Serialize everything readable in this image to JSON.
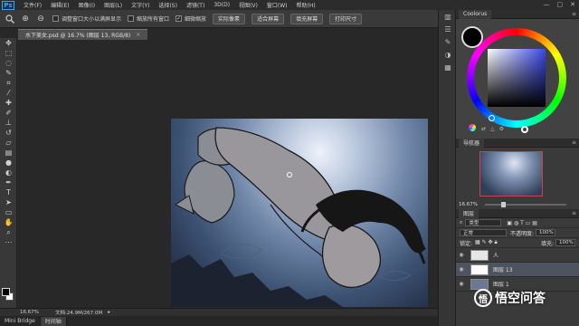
{
  "app": {
    "logo": "Ps"
  },
  "menubar": {
    "items": [
      "文件(F)",
      "编辑(E)",
      "图像(I)",
      "图层(L)",
      "文字(Y)",
      "选择(S)",
      "滤镜(T)",
      "3D(D)",
      "视图(V)",
      "窗口(W)",
      "帮助(H)"
    ]
  },
  "window_controls": {
    "minimize": "—",
    "maximize": "▢",
    "close": "✕"
  },
  "options": {
    "tool_icon": "zoom-tool-icon",
    "zoom_in": "⊕",
    "zoom_out": "⊖",
    "checkboxes": [
      {
        "label": "调整窗口大小以满屏显示",
        "checked": false
      },
      {
        "label": "缩放所有窗口",
        "checked": false
      },
      {
        "label": "细微缩放",
        "checked": true
      }
    ],
    "buttons": [
      "实际像素",
      "适合屏幕",
      "填充屏幕",
      "打印尺寸"
    ]
  },
  "document": {
    "tab_title": "水下美女.psd @ 16.7% (图层 13, RGB/8)",
    "close": "×"
  },
  "status": {
    "zoom": "16.67%",
    "doc_info": "文档:24.9M/267.0M",
    "arrow": "▸"
  },
  "bottom_tabs": [
    "Mini Bridge",
    "时间轴"
  ],
  "coolorus": {
    "tab": "Coolorus",
    "menu": "≡"
  },
  "navigator": {
    "tab": "导航器",
    "zoom": "16.67%"
  },
  "layers": {
    "tab": "图层",
    "filter_kind": "类型",
    "blend_mode": "正常",
    "opacity_label": "不透明度:",
    "opacity_value": "100%",
    "lock_label": "锁定:",
    "fill_label": "填充:",
    "fill_value": "100%",
    "items": [
      {
        "name": "人",
        "visible": true,
        "selected": false
      },
      {
        "name": "图层 13",
        "visible": true,
        "selected": true
      },
      {
        "name": "图层 1",
        "visible": true,
        "selected": false
      }
    ]
  },
  "watermark": {
    "logo": "悟",
    "text": "悟空问答"
  }
}
